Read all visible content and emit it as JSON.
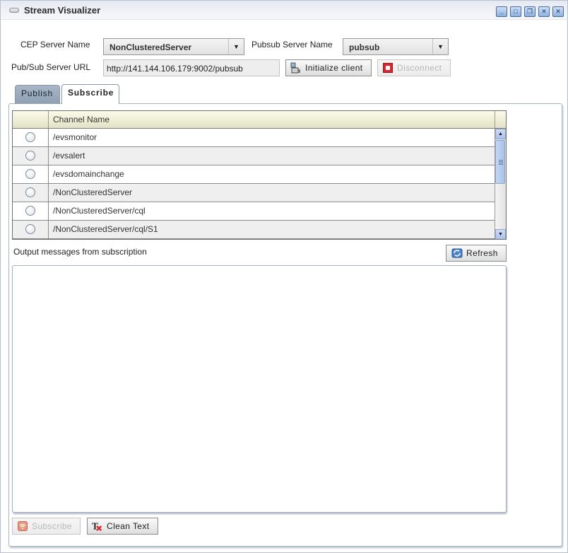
{
  "window": {
    "title": "Stream Visualizer",
    "controls": [
      "minimize",
      "maximize",
      "restore",
      "detach-close",
      "close"
    ]
  },
  "form": {
    "cep_server_label": "CEP Server Name",
    "cep_server_value": "NonClusteredServer",
    "pubsub_server_label": "Pubsub Server Name",
    "pubsub_server_value": "pubsub",
    "url_label": "Pub/Sub Server URL",
    "url_value": "http://141.144.106.179:9002/pubsub",
    "initialize_label": "Initialize client",
    "disconnect_label": "Disconnect"
  },
  "tabs": [
    {
      "label": "Publish",
      "active": false
    },
    {
      "label": "Subscribe",
      "active": true
    }
  ],
  "channels": {
    "header": "Channel Name",
    "rows": [
      {
        "name": "/evsmonitor",
        "selected": false
      },
      {
        "name": "/evsalert",
        "selected": false
      },
      {
        "name": "/evsdomainchange",
        "selected": false
      },
      {
        "name": "/NonClusteredServer",
        "selected": false
      },
      {
        "name": "/NonClusteredServer/cql",
        "selected": false
      },
      {
        "name": "/NonClusteredServer/cql/S1",
        "selected": false
      }
    ]
  },
  "output": {
    "label": "Output messages from subscription",
    "refresh_label": "Refresh",
    "text": ""
  },
  "actions": {
    "subscribe_label": "Subscribe",
    "clean_text_label": "Clean Text"
  },
  "colors": {
    "tab_inactive": "#8fa0b3",
    "header_bg": "#e4e2c7",
    "scrollbar": "#aac1ea",
    "disconnect_icon": "#d9262b",
    "subscribe_icon": "#e07050"
  }
}
